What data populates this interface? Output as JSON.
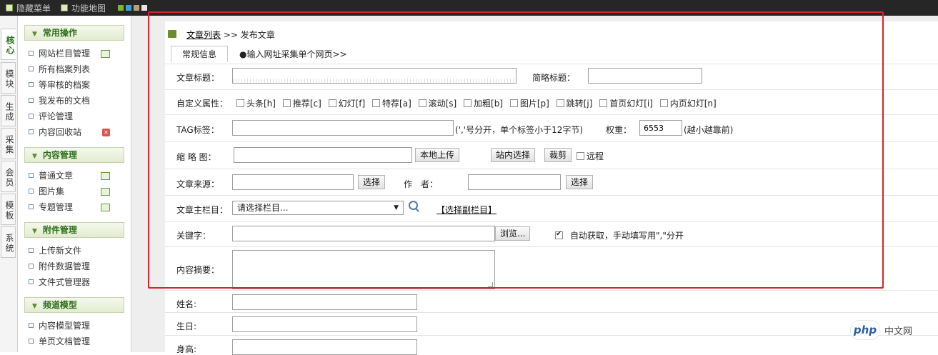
{
  "topbar": {
    "hide_menu": "隐藏菜单",
    "func_map": "功能地图",
    "swatches": [
      "#7fb526",
      "#3aa0d8",
      "#b9a079",
      "#e6e6e6"
    ]
  },
  "vtabs": [
    "核心",
    "模块",
    "生成",
    "采集",
    "会员",
    "模板",
    "系统"
  ],
  "sidebar": {
    "groups": [
      {
        "title": "常用操作",
        "items": [
          "网站栏目管理",
          "所有档案列表",
          "等审核的档案",
          "我发布的文档",
          "评论管理",
          "内容回收站"
        ]
      },
      {
        "title": "内容管理",
        "items": [
          "普通文章",
          "图片集",
          "专题管理"
        ]
      },
      {
        "title": "附件管理",
        "items": [
          "上传新文件",
          "附件数据管理",
          "文件式管理器"
        ]
      },
      {
        "title": "频道模型",
        "items": [
          "内容模型管理",
          "单页文档管理"
        ]
      }
    ]
  },
  "breadcrumb": {
    "link": "文章列表",
    "sep": ">>",
    "current": "发布文章"
  },
  "tabs": {
    "tab1": "常规信息",
    "tab2": "●输入网址采集单个网页>>"
  },
  "form": {
    "title_label": "文章标题：",
    "short_title_label": "简略标题：",
    "custom_attr_label": "自定义属性：",
    "attrs": [
      "头条[h]",
      "推荐[c]",
      "幻灯[f]",
      "特荐[a]",
      "滚动[s]",
      "加粗[b]",
      "图片[p]",
      "跳转[j]",
      "首页幻灯[i]",
      "内页幻灯[n]"
    ],
    "tag_label": "TAG标签：",
    "tag_hint": "(','号分开，单个标签小于12字节)",
    "weight_label": "权重：",
    "weight_value": "6553",
    "weight_hint": "(越小越靠前)",
    "thumb_label": "缩 略 图：",
    "upload_btn": "本地上传",
    "site_select_btn": "站内选择",
    "crop_btn": "裁剪",
    "remote_label": "远程",
    "source_label": "文章来源：",
    "select_btn": "选择",
    "author_label": "作　者：",
    "column_label": "文章主栏目：",
    "column_value": "请选择栏目...",
    "sub_column_link": "【选择副栏目】",
    "keywords_label": "关键字：",
    "browse_btn": "浏览...",
    "auto_fetch_label": "自动获取，手动填写用\",\"分开",
    "summary_label": "内容摘要：",
    "name_label": "姓名:",
    "birthday_label": "生日:",
    "height_label": "身高:"
  },
  "watermark": {
    "logo": "php",
    "text": "中文网"
  },
  "colors": {
    "highlight": "#d8232a",
    "accent_green": "#2d6e1b"
  }
}
